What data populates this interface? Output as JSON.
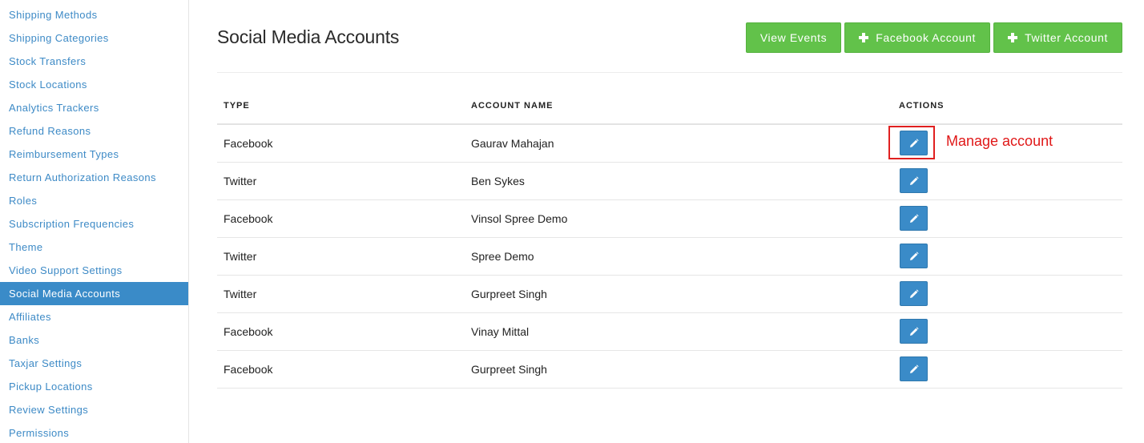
{
  "sidebar": {
    "items": [
      {
        "label": "Shipping Methods",
        "active": false
      },
      {
        "label": "Shipping Categories",
        "active": false
      },
      {
        "label": "Stock Transfers",
        "active": false
      },
      {
        "label": "Stock Locations",
        "active": false
      },
      {
        "label": "Analytics Trackers",
        "active": false
      },
      {
        "label": "Refund Reasons",
        "active": false
      },
      {
        "label": "Reimbursement Types",
        "active": false
      },
      {
        "label": "Return Authorization Reasons",
        "active": false
      },
      {
        "label": "Roles",
        "active": false
      },
      {
        "label": "Subscription Frequencies",
        "active": false
      },
      {
        "label": "Theme",
        "active": false
      },
      {
        "label": "Video Support Settings",
        "active": false
      },
      {
        "label": "Social Media Accounts",
        "active": true
      },
      {
        "label": "Affiliates",
        "active": false
      },
      {
        "label": "Banks",
        "active": false
      },
      {
        "label": "Taxjar Settings",
        "active": false
      },
      {
        "label": "Pickup Locations",
        "active": false
      },
      {
        "label": "Review Settings",
        "active": false
      },
      {
        "label": "Permissions",
        "active": false
      }
    ]
  },
  "header": {
    "title": "Social Media Accounts",
    "buttons": {
      "view_events": "View Events",
      "facebook_account": "Facebook Account",
      "twitter_account": "Twitter Account"
    }
  },
  "table": {
    "columns": [
      "TYPE",
      "ACCOUNT NAME",
      "ACTIONS"
    ],
    "rows": [
      {
        "type": "Facebook",
        "name": "Gaurav Mahajan"
      },
      {
        "type": "Twitter",
        "name": "Ben Sykes"
      },
      {
        "type": "Facebook",
        "name": "Vinsol Spree Demo"
      },
      {
        "type": "Twitter",
        "name": "Spree Demo"
      },
      {
        "type": "Twitter",
        "name": "Gurpreet Singh"
      },
      {
        "type": "Facebook",
        "name": "Vinay Mittal"
      },
      {
        "type": "Facebook",
        "name": "Gurpreet Singh"
      }
    ]
  },
  "annotation": {
    "text": "Manage account"
  },
  "icons": {
    "edit": "pencil-icon",
    "add": "plus-icon"
  },
  "colors": {
    "link": "#3d8ac6",
    "active_nav": "#3a8bc8",
    "success_button": "#62c24a",
    "edit_button": "#3a8bc8",
    "annotation": "#e01818"
  }
}
